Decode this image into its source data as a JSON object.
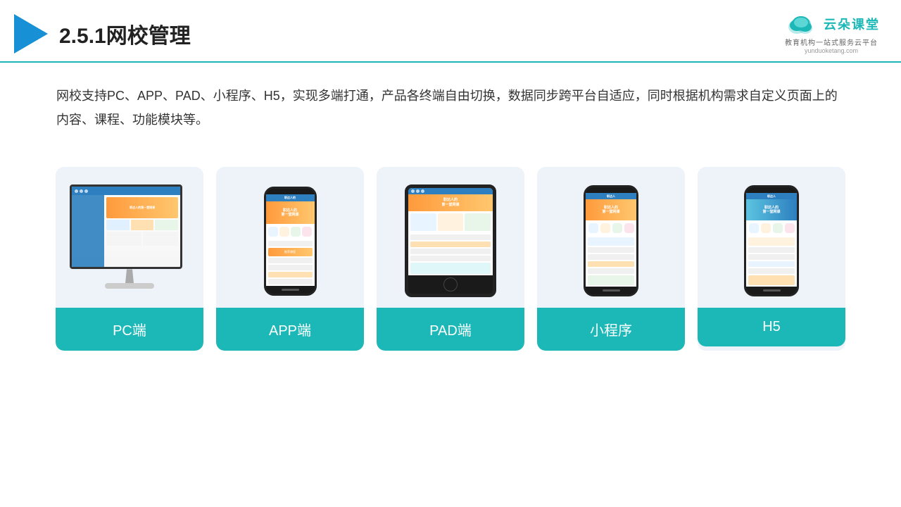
{
  "header": {
    "title": "2.5.1网校管理",
    "logo_text": "云朵课堂",
    "logo_url": "yunduoketang.com",
    "logo_tagline": "教育机构一站式服务云平台"
  },
  "description": {
    "text": "网校支持PC、APP、PAD、小程序、H5，实现多端打通，产品各终端自由切换，数据同步跨平台自适应，同时根据机构需求自定义页面上的内容、课程、功能模块等。"
  },
  "cards": [
    {
      "id": "pc",
      "label": "PC端"
    },
    {
      "id": "app",
      "label": "APP端"
    },
    {
      "id": "pad",
      "label": "PAD端"
    },
    {
      "id": "miniapp",
      "label": "小程序"
    },
    {
      "id": "h5",
      "label": "H5"
    }
  ],
  "colors": {
    "teal": "#1cb8b8",
    "blue": "#1890d5",
    "card_bg": "#eef2f9"
  }
}
